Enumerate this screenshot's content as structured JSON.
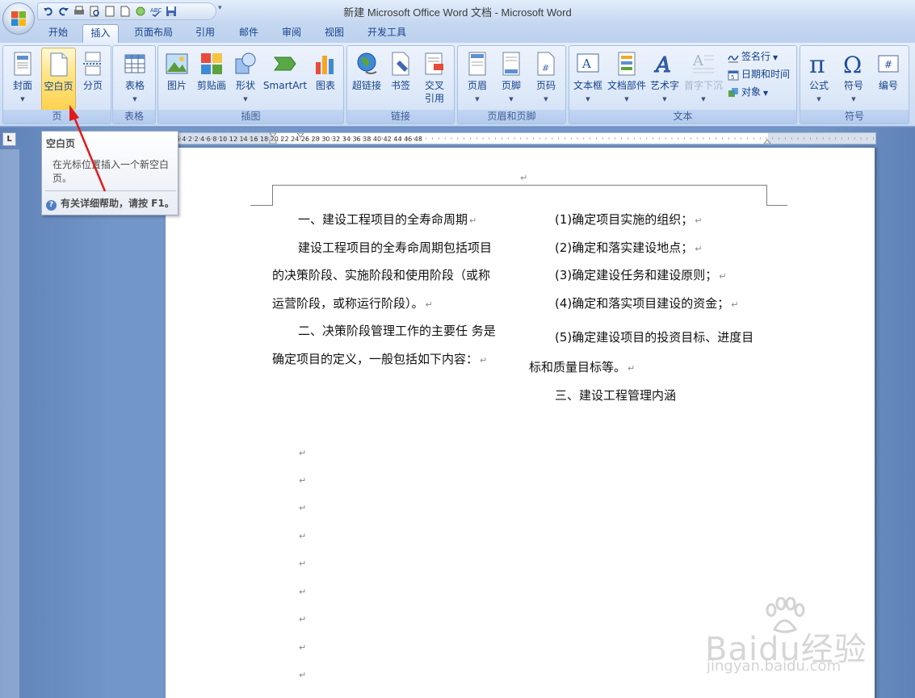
{
  "window": {
    "title": "新建 Microsoft Office Word 文档 - Microsoft Word"
  },
  "tabs": [
    {
      "label": "开始"
    },
    {
      "label": "插入"
    },
    {
      "label": "页面布局"
    },
    {
      "label": "引用"
    },
    {
      "label": "邮件"
    },
    {
      "label": "审阅"
    },
    {
      "label": "视图"
    },
    {
      "label": "开发工具"
    }
  ],
  "active_tab": "插入",
  "ribbon": {
    "groups": {
      "page": {
        "label": "页",
        "buttons": [
          "封面",
          "空白页",
          "分页"
        ]
      },
      "table": {
        "label": "表格",
        "buttons": [
          "表格"
        ]
      },
      "illustrations": {
        "label": "插图",
        "buttons": [
          "图片",
          "剪贴画",
          "形状",
          "SmartArt",
          "图表"
        ]
      },
      "links": {
        "label": "链接",
        "buttons": [
          "超链接",
          "书签",
          "交叉\n引用"
        ]
      },
      "header_footer": {
        "label": "页眉和页脚",
        "buttons": [
          "页眉",
          "页脚",
          "页码"
        ]
      },
      "text": {
        "label": "文本",
        "buttons": [
          "文本框",
          "文档部件",
          "艺术字",
          "首字下沉"
        ],
        "small": [
          "签名行",
          "日期和时间",
          "对象"
        ]
      },
      "symbols": {
        "label": "符号",
        "buttons": [
          "公式",
          "符号",
          "编号"
        ]
      }
    }
  },
  "tooltip": {
    "title": "空白页",
    "description": "在光标位置插入一个新空白页。",
    "help": "有关详细帮助，请按 F1。"
  },
  "ruler": {
    "marks": "8  6  4  2     2  4  6  8  10  12  14  16  18  20  22  24  26  28  30  32  34  36  38  40  42  44  46  48"
  },
  "document": {
    "left_column": [
      "一、建设工程项目的全寿命周期",
      "建设工程项目的全寿命周期包括项目",
      "的决策阶段、实施阶段和使用阶段（或称",
      "运营阶段，或称运行阶段）。",
      "二、决策阶段管理工作的主要任  务是",
      "确定项目的定义，一般包括如下内容："
    ],
    "right_column": [
      "(1)确定项目实施的组织；",
      "(2)确定和落实建设地点；",
      "(3)确定建设任务和建设原则；",
      "(4)确定和落实项目建设的资金；",
      "(5)确定建设项目的投资目标、进度目",
      "标和质量目标等。",
      "三、建设工程管理内涵"
    ],
    "paragraph_mark": "↵"
  },
  "watermark": {
    "brand": "Baidu经验",
    "url": "jingyan.baidu.com"
  },
  "colors": {
    "accent": "#15428b",
    "highlight": "#ffd24d",
    "arrow": "#e01b1b"
  }
}
